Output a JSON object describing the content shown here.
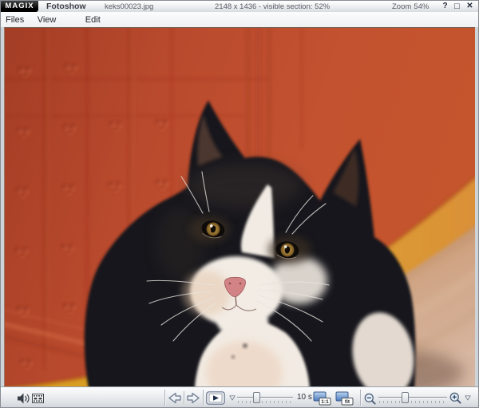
{
  "titlebar": {
    "brand": "MAGIX",
    "app_title": "Fotoshow",
    "filename": "keks00023.jpg",
    "image_info": "2148 x 1436  -  visible section:  52%",
    "zoom_label": "Zoom",
    "zoom_value": "54%",
    "help_glyph": "?",
    "maximize_glyph": "□",
    "close_glyph": "✕"
  },
  "menubar": {
    "items": [
      {
        "label": "Files"
      },
      {
        "label": "View"
      },
      {
        "label": "Edit"
      }
    ]
  },
  "photo": {
    "colors": {
      "wall_red": "#b94a2d",
      "baseboard_yellow": "#d79b25",
      "floor_tan": "#cfa382",
      "cat_black": "#17141a",
      "cat_white": "#f1ebe3",
      "eye_amber": "#a8803c",
      "nose_pink": "#d28386"
    }
  },
  "toolbar": {
    "duration_value": "10 s",
    "one_to_one_label": "1:1",
    "fit_label": "fit",
    "duration_slider_percent": 34,
    "zoom_slider_percent": 38
  }
}
